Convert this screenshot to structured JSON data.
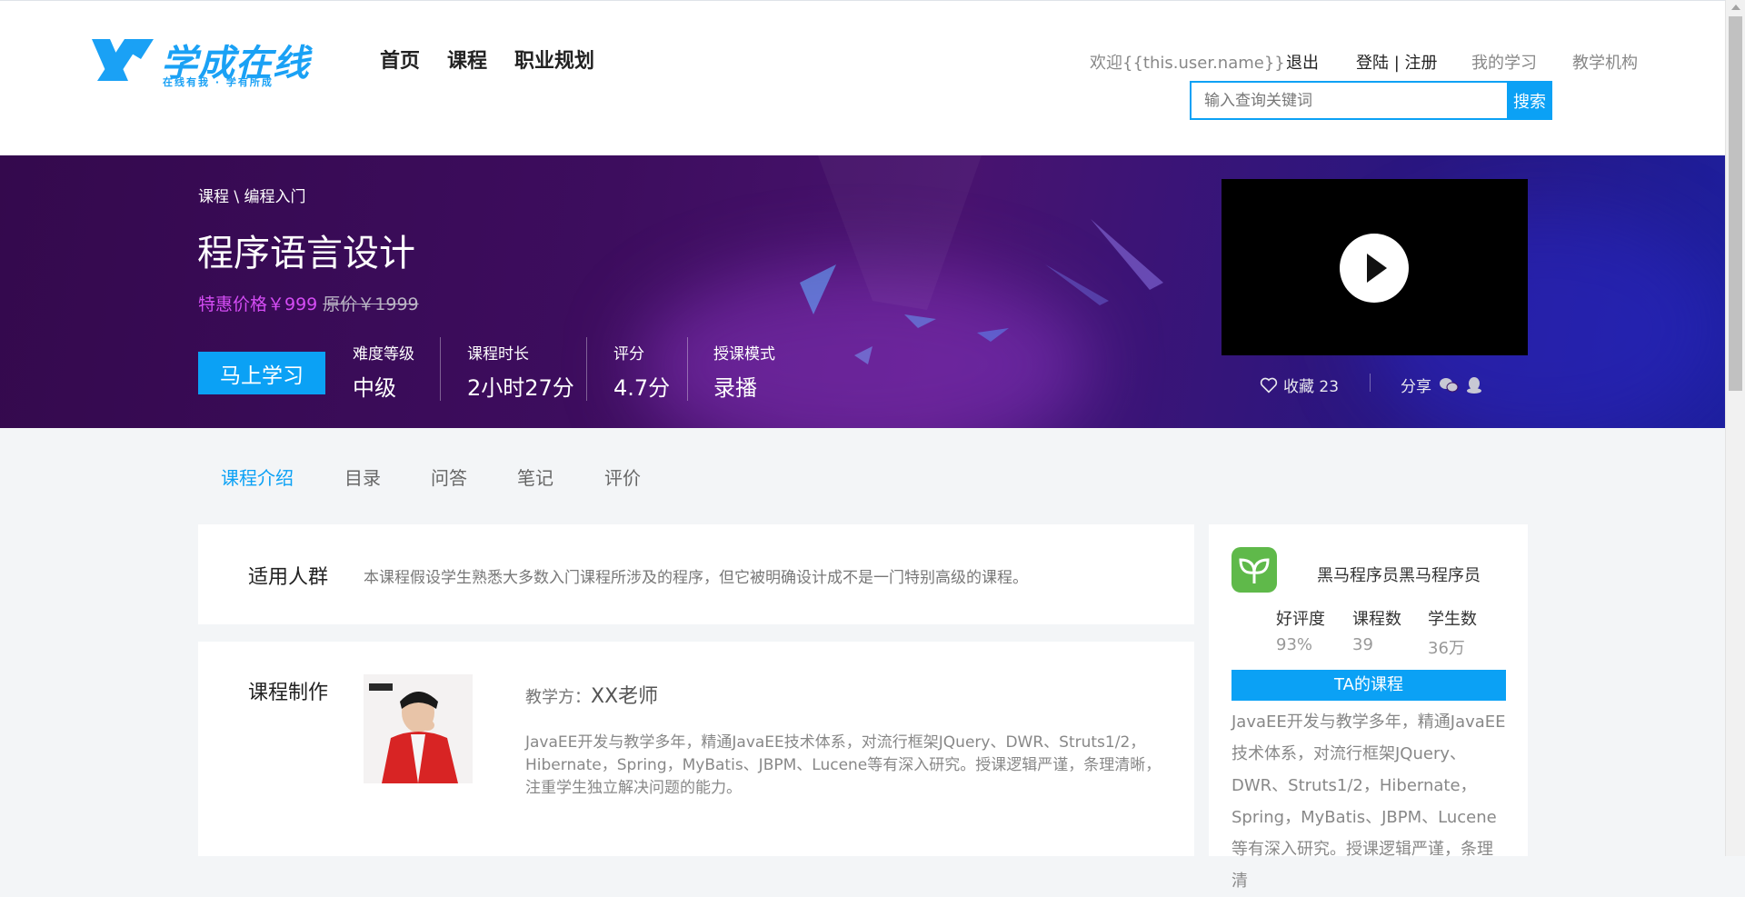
{
  "header": {
    "logo_text": "学成在线",
    "logo_slogan": "在线有我 · 学有所成",
    "nav": [
      "首页",
      "课程",
      "职业规划"
    ],
    "welcome": "欢迎{{this.user.name}}",
    "logout": "退出",
    "login_register": "登陆 | 注册",
    "my_learning": "我的学习",
    "org": "教学机构",
    "search_placeholder": "输入查询关键词",
    "search_button": "搜索"
  },
  "banner": {
    "breadcrumb": "课程 \\ 编程入门",
    "title": "程序语言设计",
    "sale_price": "特惠价格￥999",
    "original_price": "原价￥1999",
    "start_button": "马上学习",
    "stats": [
      {
        "label": "难度等级",
        "value": "中级"
      },
      {
        "label": "课程时长",
        "value": "2小时27分"
      },
      {
        "label": "评分",
        "value": "4.7分"
      },
      {
        "label": "授课模式",
        "value": "录播"
      }
    ],
    "favorite": "收藏 23",
    "share": "分享"
  },
  "tabs": [
    "课程介绍",
    "目录",
    "问答",
    "笔记",
    "评价"
  ],
  "audience": {
    "title": "适用人群",
    "text": "本课程假设学生熟悉大多数入门课程所涉及的程序，但它被明确设计成不是一门特别高级的课程。"
  },
  "production": {
    "title": "课程制作",
    "teacher_label": "教学方：",
    "teacher_name": "XX老师",
    "description": "JavaEE开发与教学多年，精通JavaEE技术体系，对流行框架JQuery、DWR、Struts1/2，Hibernate，Spring，MyBatis、JBPM、Lucene等有深入研究。授课逻辑严谨，条理清晰，注重学生独立解决问题的能力。"
  },
  "side": {
    "name": "黑马程序员黑马程序员",
    "stats": [
      {
        "label": "好评度",
        "value": "93%"
      },
      {
        "label": "课程数",
        "value": "39"
      },
      {
        "label": "学生数",
        "value": "36万"
      }
    ],
    "ta_courses": "TA的课程",
    "description": "JavaEE开发与教学多年，精通JavaEE技术体系，对流行框架JQuery、DWR、Struts1/2，Hibernate，Spring，MyBatis、JBPM、Lucene等有深入研究。授课逻辑严谨，条理清"
  },
  "colors": {
    "accent": "#0ba1f5",
    "sale_price": "#d44cf4",
    "banner_dark": "#34094d"
  }
}
